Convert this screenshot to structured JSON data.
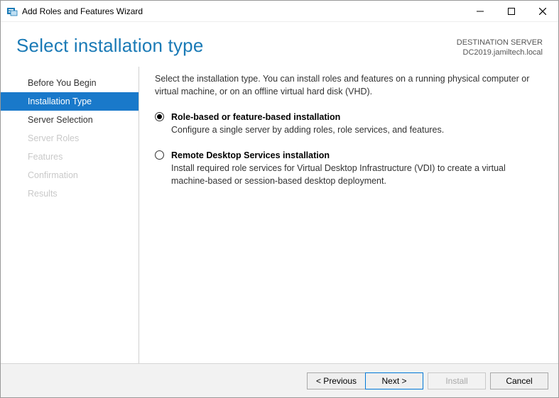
{
  "window": {
    "title": "Add Roles and Features Wizard"
  },
  "header": {
    "page_title": "Select installation type",
    "destination_label": "DESTINATION SERVER",
    "destination_server": "DC2019.jamiltech.local"
  },
  "sidebar": {
    "items": [
      {
        "label": "Before You Begin",
        "state": "enabled"
      },
      {
        "label": "Installation Type",
        "state": "active"
      },
      {
        "label": "Server Selection",
        "state": "enabled"
      },
      {
        "label": "Server Roles",
        "state": "disabled"
      },
      {
        "label": "Features",
        "state": "disabled"
      },
      {
        "label": "Confirmation",
        "state": "disabled"
      },
      {
        "label": "Results",
        "state": "disabled"
      }
    ]
  },
  "content": {
    "intro": "Select the installation type. You can install roles and features on a running physical computer or virtual machine, or on an offline virtual hard disk (VHD).",
    "options": [
      {
        "title": "Role-based or feature-based installation",
        "desc": "Configure a single server by adding roles, role services, and features.",
        "selected": true
      },
      {
        "title": "Remote Desktop Services installation",
        "desc": "Install required role services for Virtual Desktop Infrastructure (VDI) to create a virtual machine-based or session-based desktop deployment.",
        "selected": false
      }
    ]
  },
  "footer": {
    "previous": "< Previous",
    "next": "Next >",
    "install": "Install",
    "cancel": "Cancel"
  }
}
